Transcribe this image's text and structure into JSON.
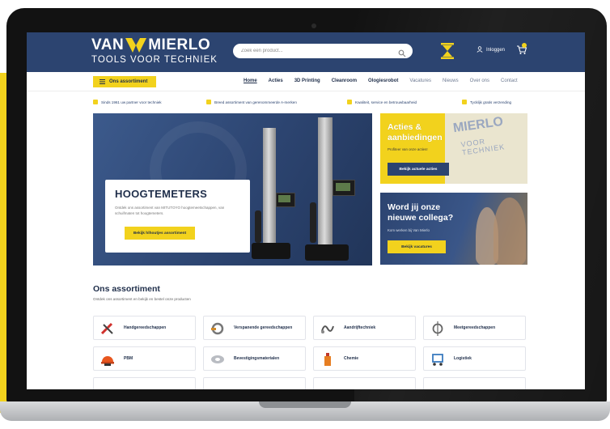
{
  "brand": {
    "name_left": "VAN",
    "name_right": "MIERLO",
    "tagline": "TOOLS VOOR TECHNIEK",
    "colors": {
      "navy": "#2c4470",
      "yellow": "#f2d21d",
      "dark_text": "#1f2e4a"
    }
  },
  "header": {
    "search_placeholder": "Zoek een product...",
    "login_label": "Inloggen"
  },
  "navbar": {
    "assortment_button": "Ons assortiment",
    "links": [
      "Home",
      "Acties",
      "3D Printing",
      "Cleanroom",
      "Ologiesrobot",
      "Vacatures",
      "Nieuws",
      "Over ons",
      "Contact"
    ]
  },
  "usps": [
    "Sinds 1961 uw partner voor techniek",
    "Breed assortiment van gerenommeerde A-merken",
    "Kwaliteit, service en betrouwbaarheid",
    "Tycklijk gratis verzending"
  ],
  "hero": {
    "title": "HOOGTEMETERS",
    "text": "Ontdek ons assortiment van MITUTOYO hoogtemeetschappen, van schuifmaten tot hoogtemeters.",
    "button": "Bekijk hlhoutjes assortiment"
  },
  "promo_actions": {
    "title": "Acties & aanbiedingen",
    "text": "Profiteer van onze acties!",
    "button": "Bekijk actuele acties"
  },
  "promo_jobs": {
    "title": "Word jij onze nieuwe collega?",
    "text": "Kom werken bij Van Mierlo",
    "button": "Bekijk vacatures"
  },
  "assortment": {
    "title": "Ons assortiment",
    "subtitle": "Ontdek ons assortiment en bekijk en bestel onze producten",
    "categories": [
      {
        "label": "Handgereedschappen",
        "icon": "hand-tools-icon"
      },
      {
        "label": "Verspanende gereedschappen",
        "icon": "cutting-tools-icon"
      },
      {
        "label": "Aandrijftechniek",
        "icon": "drive-technology-icon"
      },
      {
        "label": "Meetgereedschappen",
        "icon": "measuring-tools-icon"
      },
      {
        "label": "PBM",
        "icon": "safety-helmet-icon"
      },
      {
        "label": "Bevestigingsmaterialen",
        "icon": "fasteners-icon"
      },
      {
        "label": "Chemie",
        "icon": "chemistry-bottle-icon"
      },
      {
        "label": "Logistiek",
        "icon": "logistics-cart-icon"
      }
    ]
  }
}
